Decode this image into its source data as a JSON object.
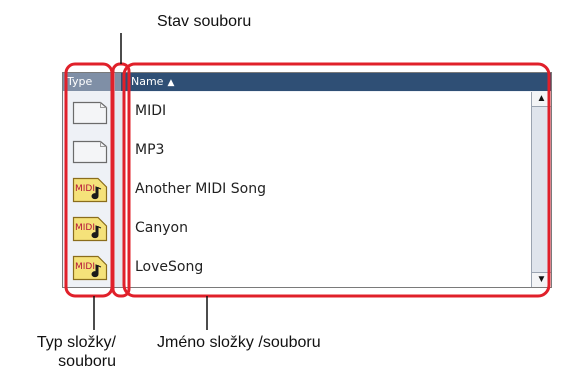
{
  "callouts": {
    "status": "Stav souboru",
    "type_line1": "Typ složky/",
    "type_line2": "souboru",
    "name": "Jméno složky /souboru"
  },
  "header": {
    "type_label": "Type",
    "name_label": "Name",
    "sort_indicator": "▲"
  },
  "rows": [
    {
      "label": "MIDI",
      "icon": "folder-icon"
    },
    {
      "label": "MP3",
      "icon": "folder-icon"
    },
    {
      "label": "Another MIDI Song",
      "icon": "midi-file-icon"
    },
    {
      "label": "Canyon",
      "icon": "midi-file-icon"
    },
    {
      "label": "LoveSong",
      "icon": "midi-file-icon"
    }
  ],
  "midi_badge_text": "MIDI",
  "colors": {
    "highlight": "#e0202a",
    "header_dark": "#2f4f75",
    "midi_badge": "#f5e27a"
  }
}
